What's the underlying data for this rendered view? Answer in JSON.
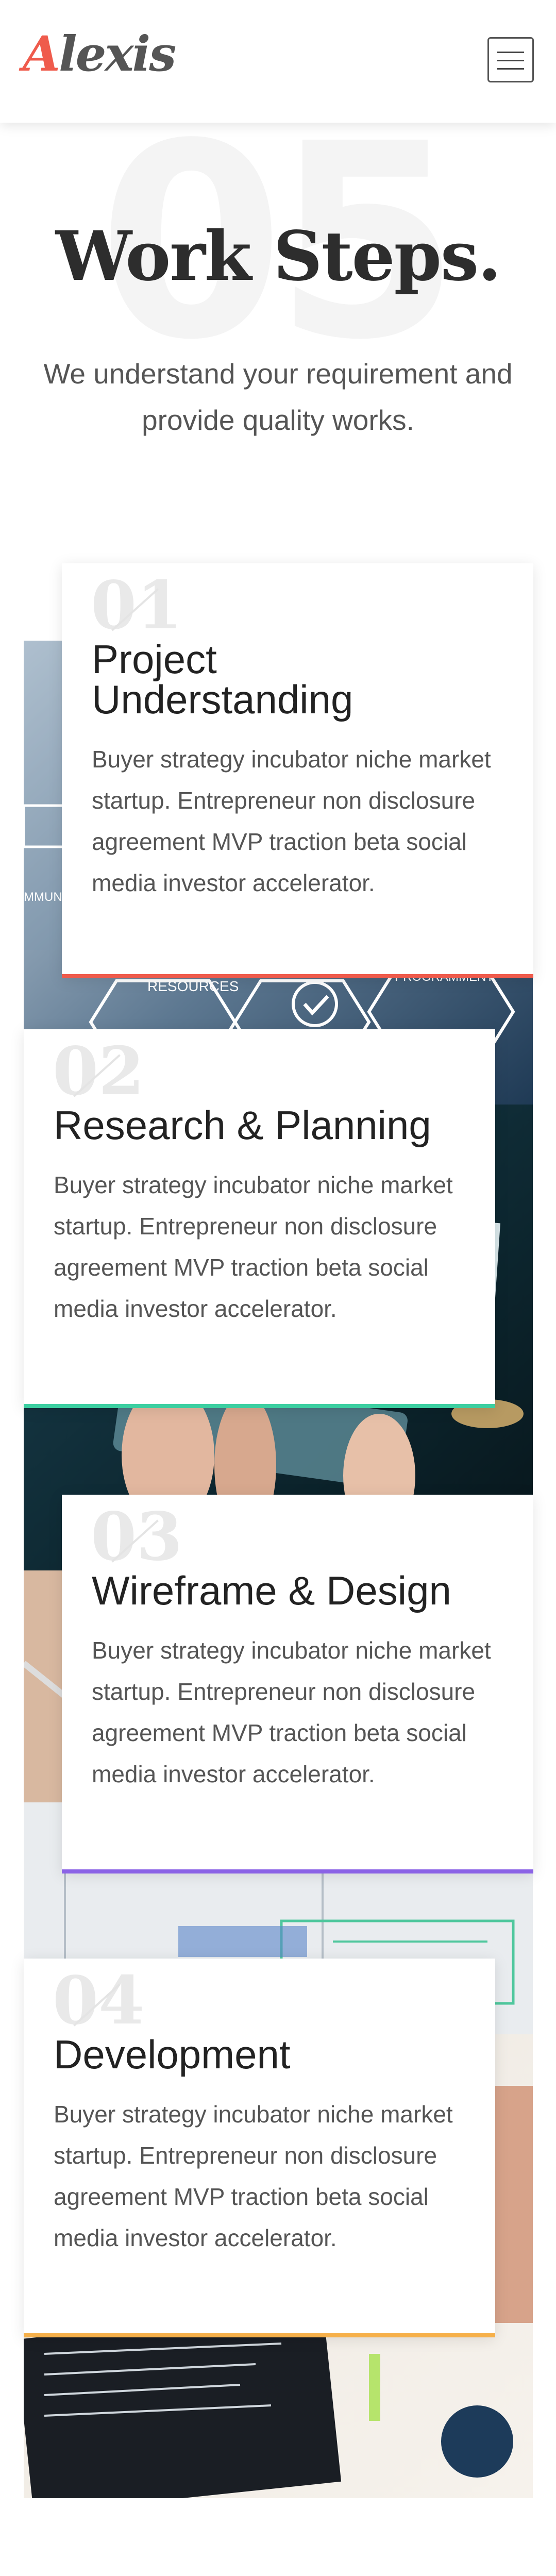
{
  "header": {
    "logo_first": "A",
    "logo_rest": "lexis",
    "menu_icon": "hamburger-menu-icon"
  },
  "section": {
    "background_number": "05",
    "title": "Work Steps.",
    "subtitle": "We understand your requirement and provide quality works."
  },
  "steps": [
    {
      "number": "01",
      "title": "Project Understanding",
      "description": "Buyer strategy incubator niche market startup. Entrepreneur non disclosure agreement MVP traction beta social media investor accelerator.",
      "accent": "#ef5b4c",
      "image_labels": [
        "RESOURCES",
        "PROGRAMMENT",
        "MMUNI"
      ]
    },
    {
      "number": "02",
      "title": "Research & Planning",
      "description": "Buyer strategy incubator niche market startup. Entrepreneur non disclosure agreement MVP traction beta social media investor accelerator.",
      "accent": "#3ccfa1"
    },
    {
      "number": "03",
      "title": "Wireframe & Design",
      "description": "Buyer strategy incubator niche market startup. Entrepreneur non disclosure agreement MVP traction beta social media investor accelerator.",
      "accent": "#8b63e6"
    },
    {
      "number": "04",
      "title": "Development",
      "description": "Buyer strategy incubator niche market startup. Entrepreneur non disclosure agreement MVP traction beta social media investor accelerator.",
      "accent": "#f6b04a"
    }
  ],
  "colors": {
    "brand": "#ef5b4c",
    "heading": "#2d2d2d",
    "body_text": "#555555"
  }
}
